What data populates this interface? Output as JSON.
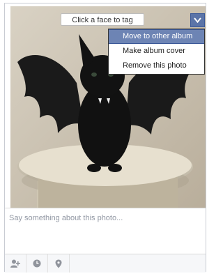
{
  "photo": {
    "tag_prompt": "Click a face to tag",
    "alt": "Black kitten with bat wings on a stool"
  },
  "options_menu": {
    "items": [
      {
        "label": "Move to other album",
        "active": true
      },
      {
        "label": "Make album cover",
        "active": false
      },
      {
        "label": "Remove this photo",
        "active": false
      }
    ]
  },
  "caption": {
    "placeholder": "Say something about this photo..."
  },
  "toolbar": {
    "icons": [
      "tag-person-icon",
      "clock-icon",
      "location-pin-icon"
    ]
  },
  "colors": {
    "accent": "#6d84b4",
    "button": "#5b74a8",
    "border": "#c9ccd3",
    "placeholder": "#9197a3"
  }
}
